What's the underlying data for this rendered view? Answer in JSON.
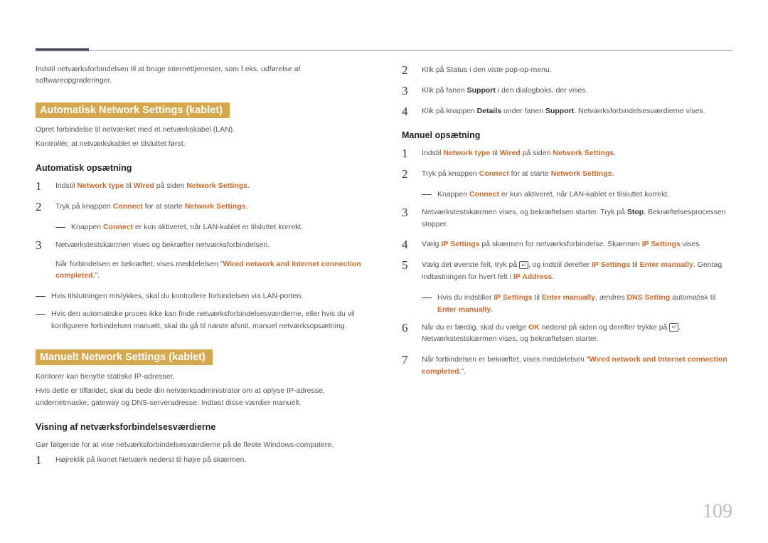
{
  "page_number": "109",
  "left": {
    "intro": "Indstil netværksforbindelsen til at bruge internettjenester, som f.eks. udførelse af softwareopgraderinger.",
    "section1_title": "Automatisk Network Settings (kablet)",
    "section1_p1": "Opret forbindelse til netværket med et netværkskabel (LAN).",
    "section1_p2": "Kontrollér, at netværkskablet er tilsluttet først.",
    "sub1": "Automatisk opsætning",
    "s1_step1_a": "Indstil ",
    "s1_step1_b": "Network type",
    "s1_step1_c": " til ",
    "s1_step1_d": "Wired",
    "s1_step1_e": " på siden ",
    "s1_step1_f": "Network Settings",
    "s1_step1_g": ".",
    "s1_step2_a": "Tryk på knappen ",
    "s1_step2_b": "Connect",
    "s1_step2_c": " for at starte ",
    "s1_step2_d": "Network Settings",
    "s1_step2_e": ".",
    "s1_note1_a": "Knappen ",
    "s1_note1_b": "Connect",
    "s1_note1_c": " er kun aktiveret, når LAN-kablet er tilsluttet korrekt.",
    "s1_step3": "Netværkstestskærmen vises og bekræfter netværksforbindelsen.",
    "s1_step3b_a": "Når forbindelsen er bekræftet, vises meddelelsen \"",
    "s1_step3b_b": "Wired network and Internet connection completed.",
    "s1_step3b_c": "\".",
    "s1_note2": "Hvis tilslutningen mislykkes, skal du kontrollere forbindelsen via LAN-porten.",
    "s1_note3": "Hvis den automatiske proces ikke kan finde netværksforbindelsesværdierne, eller hvis du vil konfigurere forbindelsen manuelt, skal du gå til næste afsnit, manuel netværksopsætning.",
    "section2_title": "Manuelt Network Settings (kablet)",
    "section2_p1": "Kontorer kan benytte statiske IP-adresser.",
    "section2_p2": "Hvis dette er tilfældet, skal du bede din netværksadministrator om at oplyse IP-adresse, undernetmaske, gateway og DNS-serveradresse. Indtast disse værdier manuelt.",
    "sub2": "Visning af netværksforbindelsesværdierne",
    "sub2_intro": "Gør følgende for at vise netværksforbindelsesværdierne på de fleste Windows-computere.",
    "s2_step1": "Højreklik på ikonet Netværk nederst til højre på skærmen."
  },
  "right": {
    "r_step2": "Klik på Status i den viste pop-op-menu.",
    "r_step3_a": "Klik på fanen ",
    "r_step3_b": "Support",
    "r_step3_c": " i den dialogboks, der vises.",
    "r_step4_a": "Klik på knappen ",
    "r_step4_b": "Details",
    "r_step4_c": " under fanen ",
    "r_step4_d": "Support",
    "r_step4_e": ". Netværksforbindelsesværdierne vises.",
    "sub3": "Manuel opsætning",
    "m_step1_a": "Indstil ",
    "m_step1_b": "Network type",
    "m_step1_c": " til ",
    "m_step1_d": "Wired",
    "m_step1_e": " på siden ",
    "m_step1_f": "Network Settings",
    "m_step1_g": ".",
    "m_step2_a": "Tryk på knappen ",
    "m_step2_b": "Connect",
    "m_step2_c": " for at starte ",
    "m_step2_d": "Network Settings",
    "m_step2_e": ".",
    "m_note1_a": "Knappen ",
    "m_note1_b": "Connect",
    "m_note1_c": " er kun aktiveret, når LAN-kablet er tilsluttet korrekt.",
    "m_step3_a": "Netværkstestskærmen vises, og bekræftelsen starter. Tryk på ",
    "m_step3_b": "Stop",
    "m_step3_c": ". Bekræftelsesprocessen stopper.",
    "m_step4_a": "Vælg ",
    "m_step4_b": "IP Settings",
    "m_step4_c": " på skærmen for netværksforbindelse. Skærmen ",
    "m_step4_d": "IP Settings",
    "m_step4_e": " vises.",
    "m_step5_a": "Vælg det øverste felt, tryk på ",
    "m_step5_b": ", og indstil derefter ",
    "m_step5_c": "IP Settings",
    "m_step5_d": " til ",
    "m_step5_e": "Enter manually",
    "m_step5_f": ". Gentag indtastningen for hvert felt i ",
    "m_step5_g": "IP Address",
    "m_step5_h": ".",
    "m_note2_a": "Hvis du indstiller ",
    "m_note2_b": "IP Settings",
    "m_note2_c": " til ",
    "m_note2_d": "Enter manually",
    "m_note2_e": ", ændres ",
    "m_note2_f": "DNS Setting",
    "m_note2_g": " automatisk til ",
    "m_note2_h": "Enter manually",
    "m_note2_i": ".",
    "m_step6_a": "Når du er færdig, skal du vælge ",
    "m_step6_b": "OK",
    "m_step6_c": " nederst på siden og derefter trykke på ",
    "m_step6_d": ". Netværkstestskærmen vises, og bekræftelsen starter.",
    "m_step7_a": "Når forbindelsen er bekræftet, vises meddelelsen \"",
    "m_step7_b": "Wired network and Internet connection completed.",
    "m_step7_c": "\"."
  },
  "icons": {
    "enter": "↵"
  }
}
